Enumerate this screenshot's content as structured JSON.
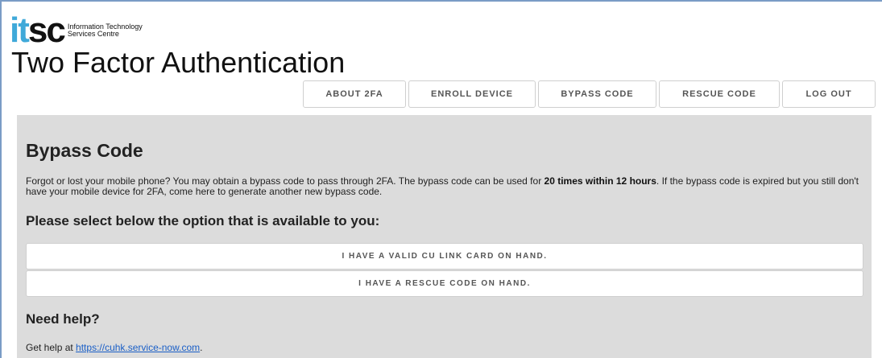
{
  "logo": {
    "mark_it": "it",
    "mark_sc": "sc",
    "line1": "Information Technology",
    "line2": "Services Centre"
  },
  "header": {
    "title": "Two Factor Authentication"
  },
  "nav": {
    "tabs": [
      {
        "label": "ABOUT 2FA"
      },
      {
        "label": "ENROLL DEVICE"
      },
      {
        "label": "BYPASS CODE"
      },
      {
        "label": "RESCUE CODE"
      },
      {
        "label": "LOG OUT"
      }
    ]
  },
  "main": {
    "title": "Bypass Code",
    "desc_part1": "Forgot or lost your mobile phone? You may obtain a bypass code to pass through 2FA. The bypass code can be used for ",
    "desc_bold": "20 times within 12 hours",
    "desc_part2": ". If the bypass code is expired but you still don't have your mobile device for 2FA, come here to generate another new bypass code.",
    "select_heading": "Please select below the option that is available to you:",
    "options": [
      {
        "label": "I HAVE A VALID CU LINK CARD ON HAND."
      },
      {
        "label": "I HAVE A RESCUE CODE ON HAND."
      }
    ],
    "help_title": "Need help?",
    "help_prefix": "Get help at ",
    "help_link": "https://cuhk.service-now.com",
    "help_suffix": "."
  },
  "colors": {
    "logo_it": "#3fa9d9",
    "panel_bg": "#dcdcdc",
    "link": "#1a5fc7"
  }
}
